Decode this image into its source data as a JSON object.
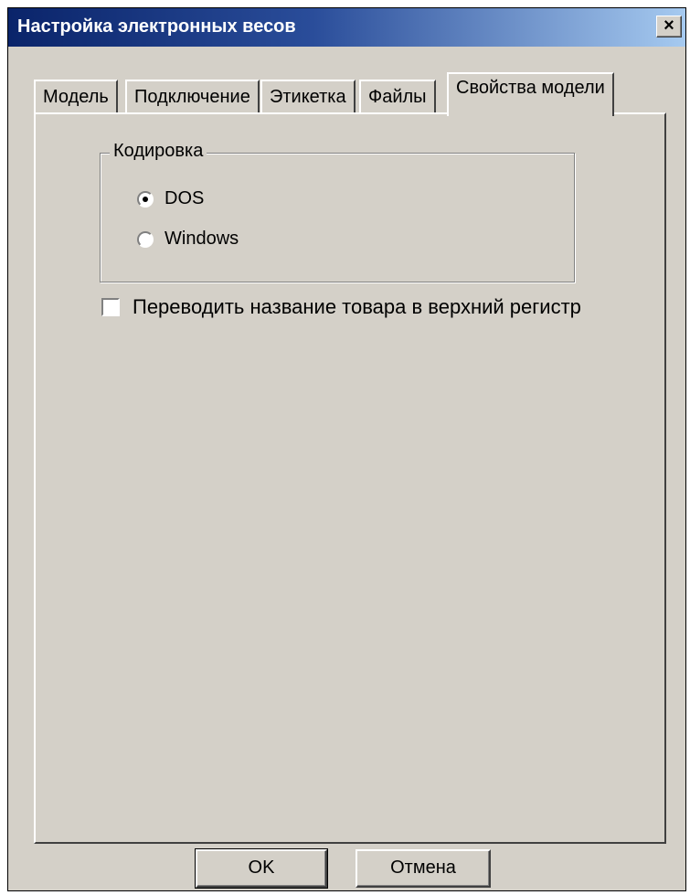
{
  "window": {
    "title": "Настройка электронных весов",
    "close_label": "×"
  },
  "tabs": [
    {
      "label": "Модель",
      "active": false
    },
    {
      "label": "Подключение",
      "active": false
    },
    {
      "label": "Этикетка",
      "active": false
    },
    {
      "label": "Файлы",
      "active": false
    },
    {
      "label": "Свойства модели",
      "active": true
    }
  ],
  "encoding": {
    "group_label": "Кодировка",
    "options": [
      {
        "label": "DOS",
        "selected": true
      },
      {
        "label": "Windows",
        "selected": false
      }
    ]
  },
  "uppercase_checkbox": {
    "label": "Переводить название товара в верхний регистр",
    "checked": false
  },
  "buttons": {
    "ok": "OK",
    "cancel": "Отмена"
  },
  "colors": {
    "face": "#d4d0c8",
    "title_start": "#0a246a",
    "title_end": "#a6caf0"
  }
}
